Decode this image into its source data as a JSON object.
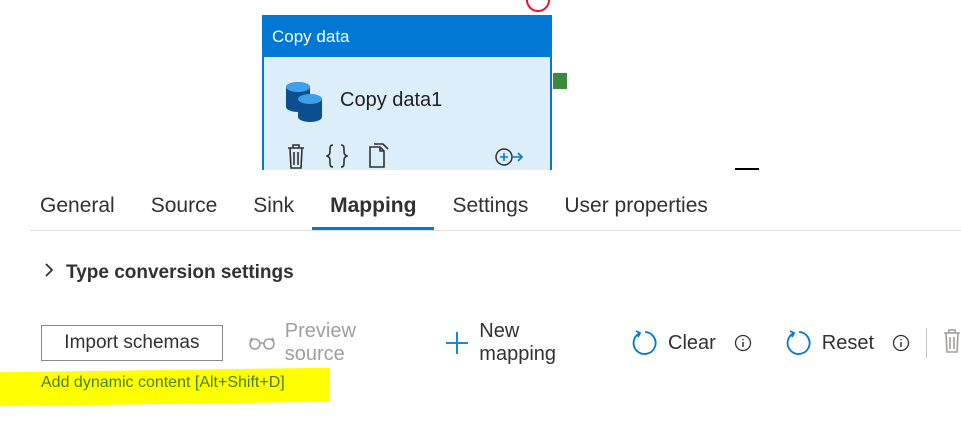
{
  "activity": {
    "header": "Copy data",
    "name": "Copy data1"
  },
  "tabs": [
    {
      "label": "General"
    },
    {
      "label": "Source"
    },
    {
      "label": "Sink"
    },
    {
      "label": "Mapping",
      "active": true
    },
    {
      "label": "Settings"
    },
    {
      "label": "User properties"
    }
  ],
  "type_conversion": {
    "label": "Type conversion settings"
  },
  "toolbar": {
    "import_label": "Import schemas",
    "preview_label": "Preview source",
    "new_mapping_label": "New mapping",
    "clear_label": "Clear",
    "reset_label": "Reset"
  },
  "dynamic_content": {
    "label": "Add dynamic content [Alt+Shift+D]"
  },
  "colors": {
    "accent": "#0078d4",
    "link": "#498205",
    "highlight": "#ffff00"
  }
}
